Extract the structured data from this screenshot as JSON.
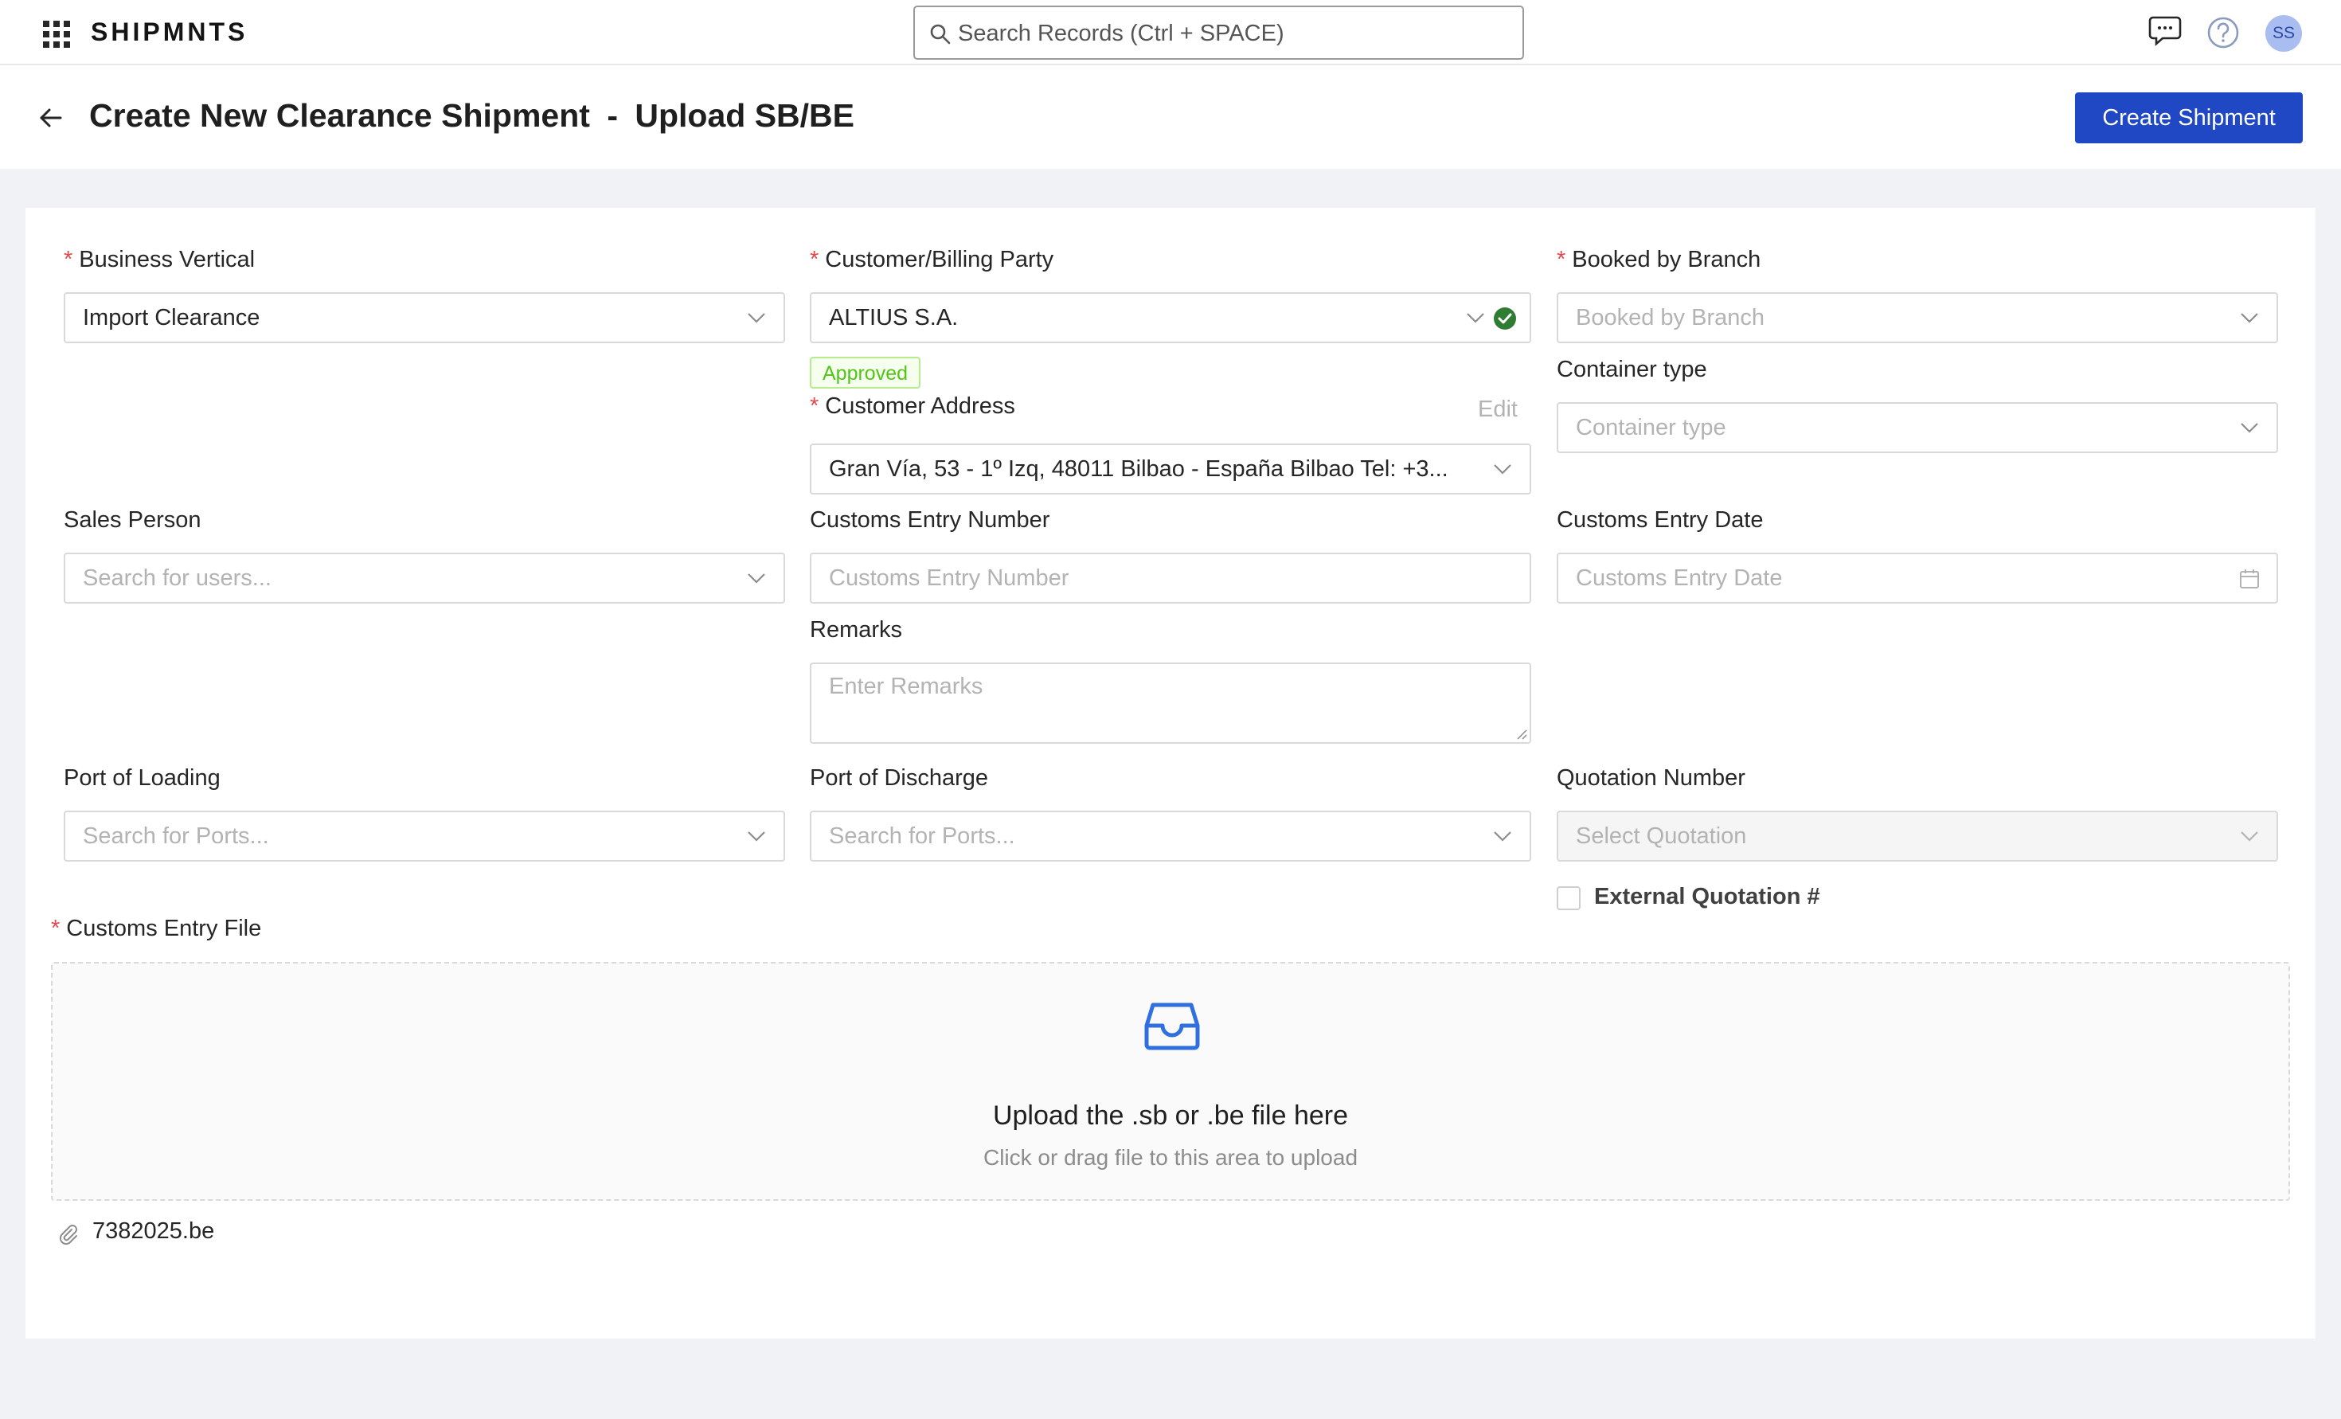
{
  "app": {
    "brand": "SHIPMNTS",
    "search_placeholder": "Search Records (Ctrl + SPACE)",
    "avatar_initials": "SS"
  },
  "page": {
    "title_main": "Create New Clearance Shipment",
    "title_sep": "-",
    "title_sub": "Upload SB/BE",
    "create_button": "Create Shipment"
  },
  "form": {
    "business_vertical": {
      "label": "Business Vertical",
      "value": "Import Clearance"
    },
    "customer": {
      "label": "Customer/Billing Party",
      "value": "ALTIUS S.A.",
      "status": "Approved"
    },
    "customer_address": {
      "label": "Customer Address",
      "edit": "Edit",
      "value": "Gran Vía, 53 - 1º Izq, 48011 Bilbao - España Bilbao Tel: +3..."
    },
    "booked_by_branch": {
      "label": "Booked by Branch",
      "placeholder": "Booked by Branch"
    },
    "container_type": {
      "label": "Container type",
      "placeholder": "Container type"
    },
    "sales_person": {
      "label": "Sales Person",
      "placeholder": "Search for users..."
    },
    "customs_entry_number": {
      "label": "Customs Entry Number",
      "placeholder": "Customs Entry Number"
    },
    "customs_entry_date": {
      "label": "Customs Entry Date",
      "placeholder": "Customs Entry Date"
    },
    "remarks": {
      "label": "Remarks",
      "placeholder": "Enter Remarks"
    },
    "port_of_loading": {
      "label": "Port of Loading",
      "placeholder": "Search for Ports..."
    },
    "port_of_discharge": {
      "label": "Port of Discharge",
      "placeholder": "Search for Ports..."
    },
    "quotation_number": {
      "label": "Quotation Number",
      "placeholder": "Select Quotation"
    },
    "external_quotation": {
      "label": "External Quotation #",
      "checked": false
    },
    "customs_entry_file": {
      "label": "Customs Entry File",
      "drop_title": "Upload the .sb or .be file here",
      "drop_hint": "Click or drag file to this area to upload",
      "files": [
        "7382025.be"
      ]
    }
  },
  "colors": {
    "primary": "#2047c4",
    "approved": "#52c41a",
    "required": "#e5484d",
    "success_icon": "#2e7d32"
  }
}
